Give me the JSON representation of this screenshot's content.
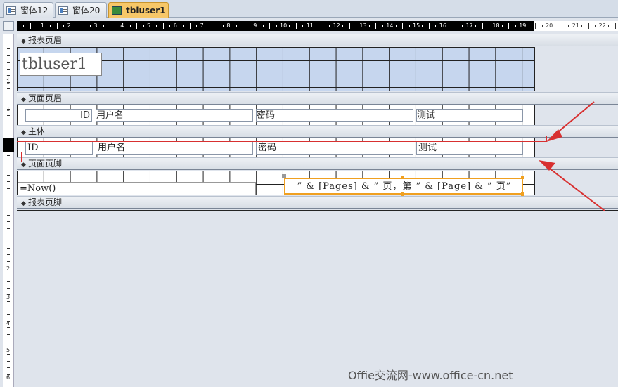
{
  "tabs": [
    {
      "label": "窗体12",
      "active": false
    },
    {
      "label": "窗体20",
      "active": false
    },
    {
      "label": "tbluser1",
      "active": true
    }
  ],
  "ruler": {
    "ticks": [
      "1",
      "2",
      "3",
      "4",
      "5",
      "6",
      "7",
      "8",
      "9",
      "10",
      "11",
      "12",
      "13",
      "14",
      "15",
      "16",
      "17",
      "18",
      "19",
      "20",
      "21",
      "22"
    ]
  },
  "vruler": {
    "labels": [
      "1",
      "1",
      "1",
      "2",
      "3",
      "4",
      "5",
      "6"
    ]
  },
  "sections": {
    "report_header": "报表页眉",
    "page_header": "页面页眉",
    "detail": "主体",
    "page_footer": "页面页脚",
    "report_footer": "报表页脚"
  },
  "report_header": {
    "title": "tbluser1"
  },
  "page_header": {
    "labels": [
      "ID",
      "用户名",
      "密码",
      "测试"
    ]
  },
  "detail": {
    "fields": [
      "ID",
      "用户名",
      "密码",
      "测试"
    ]
  },
  "page_footer": {
    "date_expr": "=Now()",
    "page_expr": "” & [Pages] & ” 页，第 ” & [Page] & ” 页”"
  },
  "watermark": "Offie交流网-www.office-cn.net",
  "colors": {
    "active_tab": "#f7c768",
    "grid_blue": "#c6d6ee",
    "annotation": "#d83030",
    "selection": "#f0a020"
  }
}
